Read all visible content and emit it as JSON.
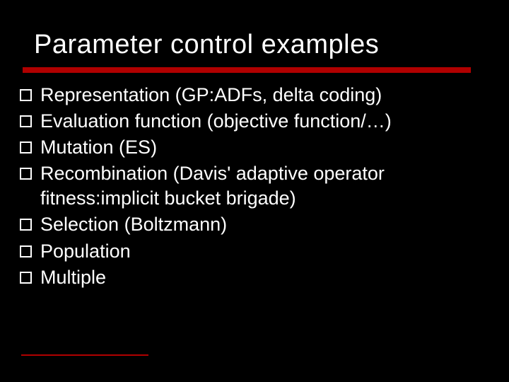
{
  "title": "Parameter control examples",
  "bullets": [
    "Representation (GP:ADFs, delta coding)",
    "Evaluation function (objective function/…)",
    "Mutation (ES)",
    "Recombination (Davis' adaptive operator fitness:implicit bucket brigade)",
    "Selection (Boltzmann)",
    "Population",
    "Multiple"
  ]
}
